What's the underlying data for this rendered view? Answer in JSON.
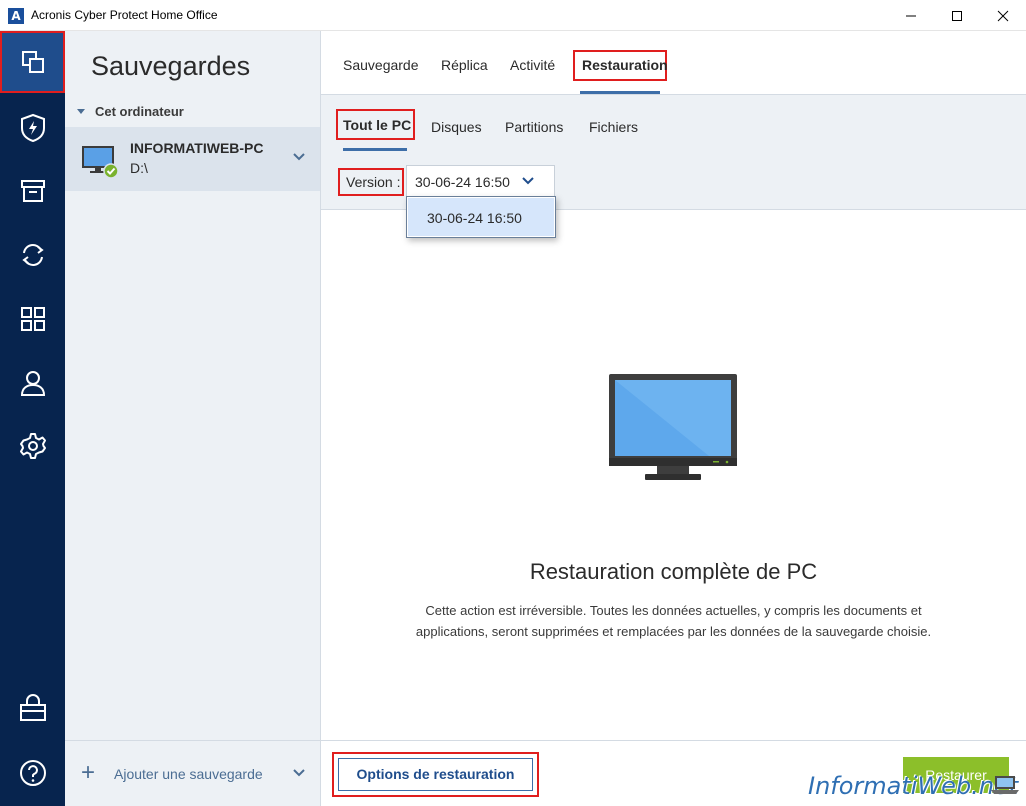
{
  "window": {
    "title": "Acronis Cyber Protect Home Office",
    "logo_letter": "A"
  },
  "rail": {
    "items": [
      {
        "icon": "copy-icon",
        "active": true
      },
      {
        "icon": "shield-icon"
      },
      {
        "icon": "archive-icon"
      },
      {
        "icon": "sync-icon"
      },
      {
        "icon": "grid-icon"
      },
      {
        "icon": "user-icon"
      },
      {
        "icon": "gear-icon"
      },
      {
        "icon": "store-icon"
      },
      {
        "icon": "help-icon"
      }
    ]
  },
  "panel": {
    "title": "Sauvegardes",
    "group_label": "Cet ordinateur",
    "backup": {
      "name": "INFORMATIWEB-PC",
      "path": "D:\\"
    },
    "add_label": "Ajouter une sauvegarde"
  },
  "tabs": [
    {
      "label": "Sauvegarde"
    },
    {
      "label": "Réplica"
    },
    {
      "label": "Activité"
    },
    {
      "label": "Restauration",
      "active": true
    }
  ],
  "subtabs": [
    {
      "label": "Tout le PC",
      "active": true
    },
    {
      "label": "Disques"
    },
    {
      "label": "Partitions"
    },
    {
      "label": "Fichiers"
    }
  ],
  "version": {
    "label": "Version :",
    "selected": "30-06-24 16:50",
    "options": [
      "30-06-24 16:50"
    ]
  },
  "content": {
    "headline": "Restauration complète de PC",
    "description_line1": "Cette action est irréversible. Toutes les données actuelles, y compris les documents et",
    "description_line2": "applications, seront supprimées et remplacées par les données de la sauvegarde choisie."
  },
  "footer": {
    "options_button": "Options de restauration",
    "restore_button": "Restaurer"
  },
  "watermark": "InformatiWeb.net",
  "colors": {
    "rail_bg": "#07244e",
    "accent_blue": "#3d6ea8",
    "restore_green": "#8cbf2a",
    "highlight_red": "#e01e1e"
  }
}
